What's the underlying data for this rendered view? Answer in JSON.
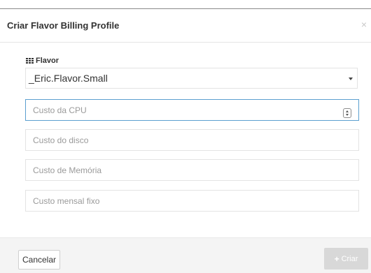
{
  "modal": {
    "title": "Criar Flavor Billing Profile",
    "close_icon": "close-icon",
    "close_glyph": "×"
  },
  "form": {
    "flavor": {
      "label": "Flavor",
      "icon": "grid-icon",
      "selected": "_Eric.Flavor.Small"
    },
    "cpu_cost": {
      "placeholder": "Custo da CPU",
      "value": ""
    },
    "disk_cost": {
      "placeholder": "Custo do disco",
      "value": ""
    },
    "memory_cost": {
      "placeholder": "Custo de Memória",
      "value": ""
    },
    "monthly_fixed_cost": {
      "placeholder": "Custo mensal fixo",
      "value": ""
    }
  },
  "footer": {
    "cancel_label": "Cancelar",
    "create_label": "Criar",
    "create_icon": "plus-icon"
  },
  "colors": {
    "focus_border": "#5b9fcf",
    "disabled_button": "#d8d8d8"
  }
}
